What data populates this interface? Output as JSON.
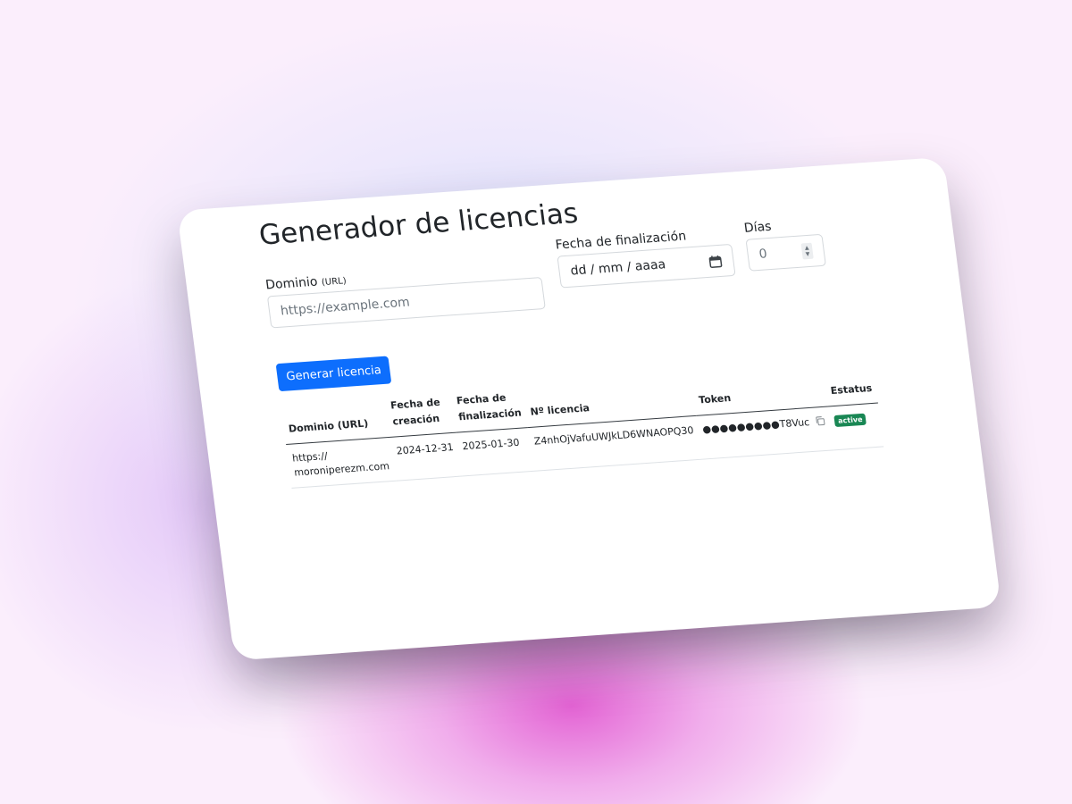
{
  "page": {
    "title": "Generador de licencias"
  },
  "form": {
    "dominio_label": "Dominio",
    "dominio_hint": "(URL)",
    "dominio_placeholder": "https://example.com",
    "fecha_label": "Fecha de finalización",
    "fecha_placeholder": "dd / mm / aaaa",
    "dias_label": "Días",
    "dias_value": "0",
    "generate_button": "Generar licencia"
  },
  "table": {
    "headers": {
      "dominio": "Dominio (URL)",
      "creacion_1": "Fecha de",
      "creacion_2": "creación",
      "finalizacion_1": "Fecha de",
      "finalizacion_2": "finalización",
      "licencia": "Nº licencia",
      "token": "Token",
      "estatus": "Estatus"
    },
    "rows": [
      {
        "dominio_1": "https://",
        "dominio_2": "moroniperezm.com",
        "creacion": "2024-12-31",
        "finalizacion": "2025-01-30",
        "licencia": "Z4nhOjVafuUWJkLD6WNAOPQ30",
        "token": "●●●●●●●●●T8Vuc",
        "estatus": "active"
      }
    ]
  },
  "colors": {
    "primary": "#0d6efd",
    "success_badge": "#198754",
    "background_pink": "#e25cd2",
    "background_lavender": "#cdd7fa"
  },
  "icons": [
    "calendar-icon",
    "copy-icon",
    "spinner-arrows-icon"
  ]
}
